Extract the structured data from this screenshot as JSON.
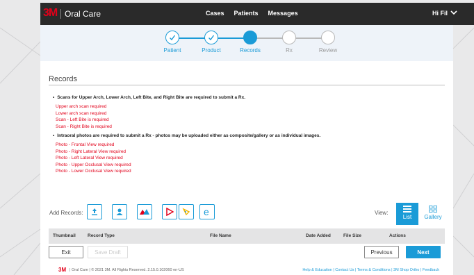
{
  "app": {
    "logo": "3M",
    "brand": "Oral Care",
    "user_greeting": "Hi Fil"
  },
  "topnav": [
    "Cases",
    "Patients",
    "Messages"
  ],
  "stepper": [
    {
      "label": "Patient",
      "state": "done"
    },
    {
      "label": "Product",
      "state": "done"
    },
    {
      "label": "Records",
      "state": "active"
    },
    {
      "label": "Rx",
      "state": "future"
    },
    {
      "label": "Review",
      "state": "future"
    }
  ],
  "records": {
    "title": "Records",
    "scan_requirement": "Scans for Upper Arch, Lower Arch, Left Bite, and Right Bite are required to submit a Rx.",
    "scan_missing": [
      "Upper arch scan required",
      "Lower arch scan required",
      "Scan - Left Bite is required",
      "Scan - Right Bite is required"
    ],
    "photo_requirement": "Intraoral photos are required to submit a Rx - photos may be uploaded either as composite/gallery or as individual images.",
    "photo_missing": [
      "Photo - Frontal View required",
      "Photo - Right Lateral View required",
      "Photo - Left Lateral View required",
      "Photo - Upper Occlusal View required",
      "Photo - Lower Occlusal View required"
    ],
    "add_records_label": "Add Records:",
    "add_buttons": [
      "upload-icon",
      "person-icon",
      "mountain-icon",
      "pdf-icon",
      "triangle-icon",
      "e-icon"
    ],
    "view_label": "View:",
    "view_list_label": "List",
    "view_gallery_label": "Gallery"
  },
  "table": {
    "columns": [
      "Thumbnail",
      "Record Type",
      "File Name",
      "Date Added",
      "File Size",
      "Actions"
    ],
    "rows": []
  },
  "actions": {
    "exit": "Exit",
    "save_draft": "Save Draft",
    "previous": "Previous",
    "next": "Next"
  },
  "footer": {
    "logo": "3M",
    "copyright": "| Oral Care | © 2021 3M. All Rights Reserved. 2.15.0.102060 en-US",
    "links": "Help & Education | Contact Us | Terms & Conditions | 3M Shop Ortho | Feedback"
  },
  "colors": {
    "accent": "#1a9bd7",
    "error": "#e2001a",
    "topbar": "#2a2a2a"
  }
}
